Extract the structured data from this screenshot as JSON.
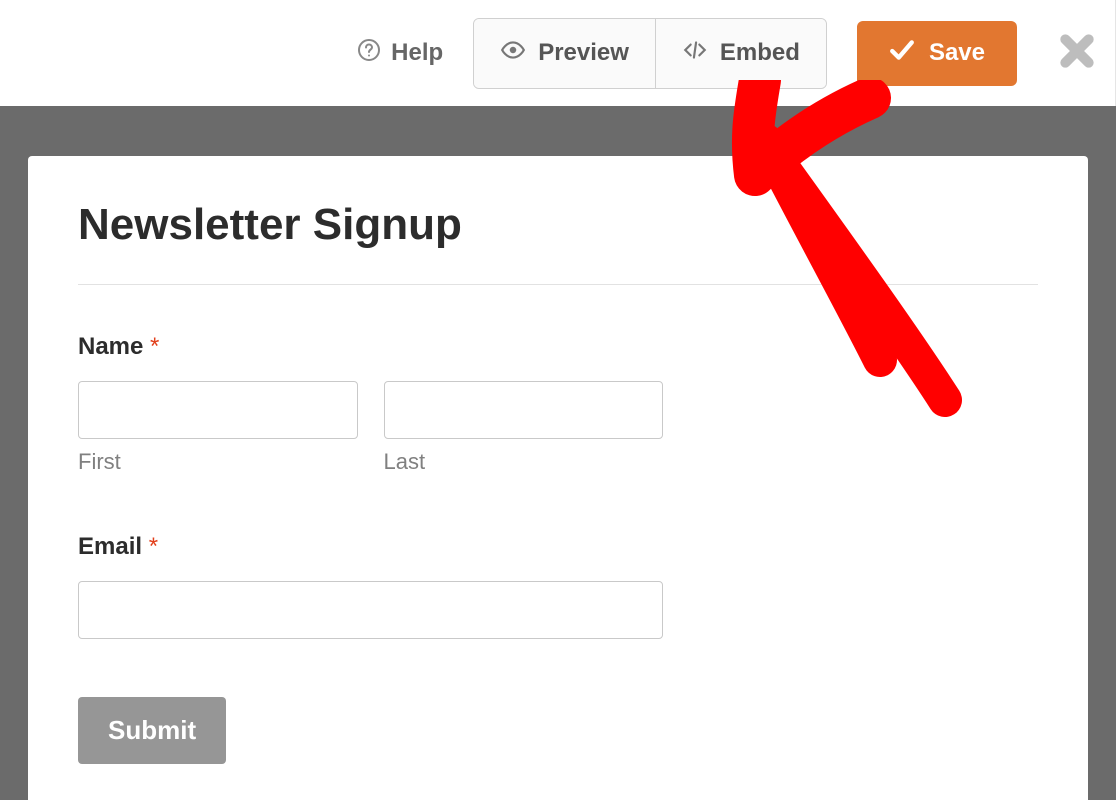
{
  "toolbar": {
    "help_label": "Help",
    "preview_label": "Preview",
    "embed_label": "Embed",
    "save_label": "Save"
  },
  "form": {
    "title": "Newsletter Signup",
    "name_label": "Name",
    "first_sublabel": "First",
    "last_sublabel": "Last",
    "email_label": "Email",
    "required_marker": "*",
    "submit_label": "Submit"
  }
}
